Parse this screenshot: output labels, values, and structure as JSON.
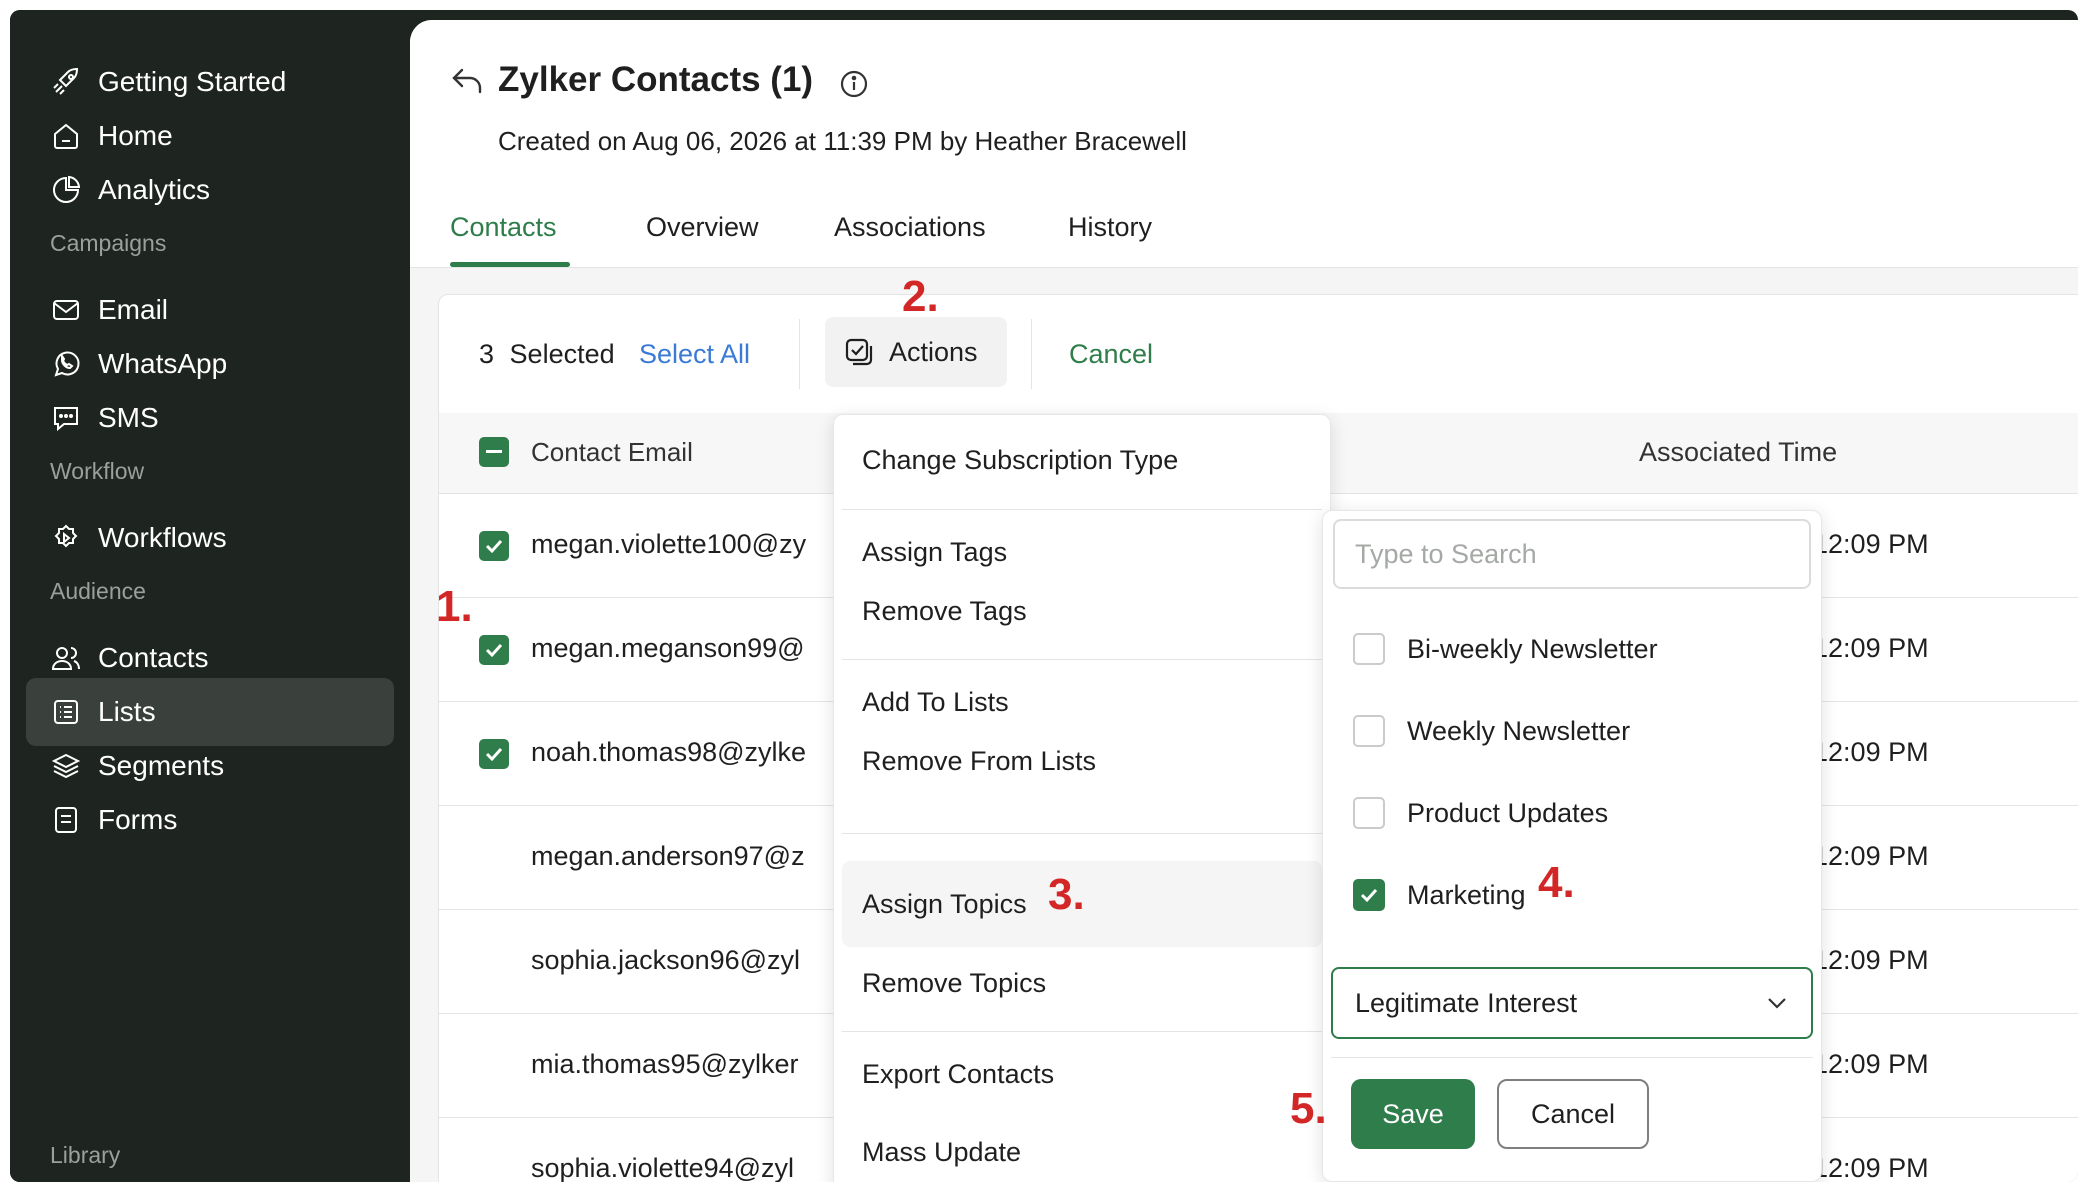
{
  "sidebar": {
    "items": [
      {
        "label": "Getting Started",
        "icon": "rocket-icon"
      },
      {
        "label": "Home",
        "icon": "home-icon"
      },
      {
        "label": "Analytics",
        "icon": "pie-chart-icon"
      },
      {
        "label": "Email",
        "icon": "envelope-icon"
      },
      {
        "label": "WhatsApp",
        "icon": "whatsapp-icon"
      },
      {
        "label": "SMS",
        "icon": "chat-bubble-icon"
      },
      {
        "label": "Workflows",
        "icon": "workflow-gear-icon"
      },
      {
        "label": "Contacts",
        "icon": "users-icon"
      },
      {
        "label": "Lists",
        "icon": "list-icon"
      },
      {
        "label": "Segments",
        "icon": "layers-icon"
      },
      {
        "label": "Forms",
        "icon": "form-icon"
      }
    ],
    "sections": [
      "Campaigns",
      "Workflow",
      "Audience",
      "Library"
    ],
    "active": "Lists"
  },
  "header": {
    "title": "Zylker Contacts (1)",
    "subtitle": "Created on Aug 06, 2026 at 11:39 PM by Heather Bracewell",
    "tabs": [
      "Contacts",
      "Overview",
      "Associations",
      "History"
    ],
    "active_tab": "Contacts"
  },
  "toolbar": {
    "selected_count": "3",
    "selected_label": "Selected",
    "select_all": "Select All",
    "actions": "Actions",
    "cancel": "Cancel"
  },
  "table": {
    "columns": [
      "Contact Email",
      "Associated Time"
    ],
    "rows": [
      {
        "email": "megan.violette100@zy",
        "time": "at 12:09 PM",
        "checked": true
      },
      {
        "email": "megan.meganson99@",
        "time": "at 12:09 PM",
        "checked": true
      },
      {
        "email": "noah.thomas98@zylke",
        "time": "at 12:09 PM",
        "checked": true
      },
      {
        "email": "megan.anderson97@z",
        "time": "at 12:09 PM",
        "checked": false
      },
      {
        "email": "sophia.jackson96@zyl",
        "time": "at 12:09 PM",
        "checked": false
      },
      {
        "email": "mia.thomas95@zylker",
        "time": "at 12:09 PM",
        "checked": false
      },
      {
        "email": "sophia.violette94@zyl",
        "time": "at 12:09 PM",
        "checked": false
      }
    ]
  },
  "actions_menu": {
    "items": [
      "Change Subscription Type",
      "Assign Tags",
      "Remove Tags",
      "Add To Lists",
      "Remove From Lists",
      "Assign Topics",
      "Remove Topics",
      "Export Contacts",
      "Mass Update"
    ],
    "highlighted": "Assign Topics"
  },
  "topics_panel": {
    "search_placeholder": "Type to Search",
    "options": [
      {
        "label": "Bi-weekly Newsletter",
        "checked": false
      },
      {
        "label": "Weekly Newsletter",
        "checked": false
      },
      {
        "label": "Product Updates",
        "checked": false
      },
      {
        "label": "Marketing",
        "checked": true
      }
    ],
    "basis": "Legitimate Interest",
    "save": "Save",
    "cancel": "Cancel"
  },
  "annotations": [
    "1.",
    "2.",
    "3.",
    "4.",
    "5."
  ],
  "colors": {
    "sidebar_bg": "#1e2420",
    "accent_green": "#2e7d4a",
    "link_blue": "#3a7bd5",
    "annotation_red": "#d32626"
  }
}
